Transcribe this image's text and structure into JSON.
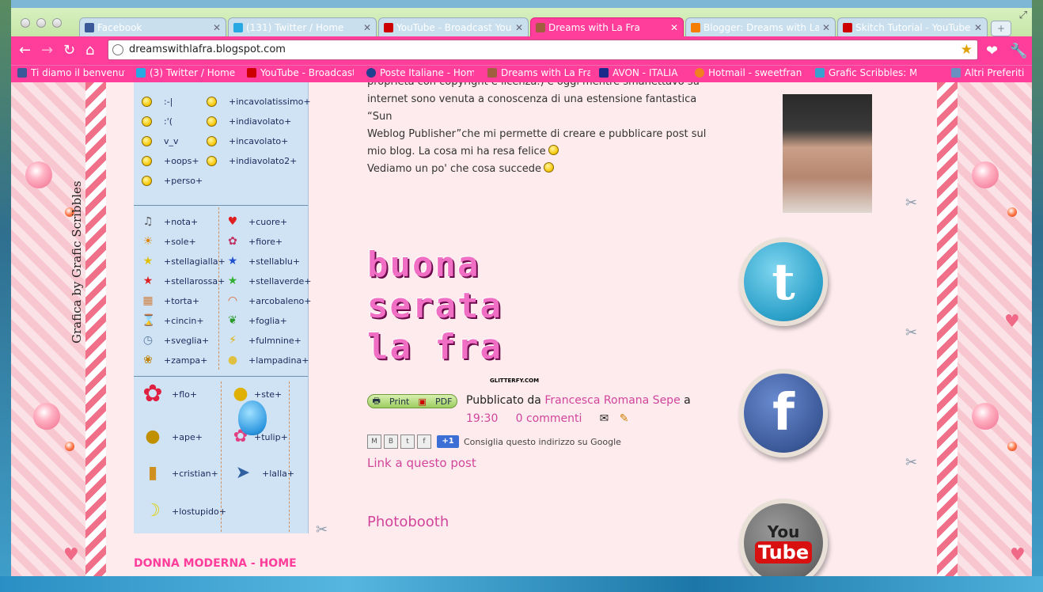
{
  "browser": {
    "tabs": [
      {
        "title": "Facebook",
        "color": "#3b5998"
      },
      {
        "title": "(131) Twitter / Home",
        "color": "#29a9e1"
      },
      {
        "title": "YouTube - Broadcast Yours",
        "color": "#cc0000"
      },
      {
        "title": "Dreams with La Fra",
        "color": "#a06040"
      },
      {
        "title": "Blogger: Dreams with La Fra",
        "color": "#f57d00"
      },
      {
        "title": "Skitch Tutorial - YouTube",
        "color": "#cc0000"
      }
    ],
    "url": "dreamswithlafra.blogspot.com",
    "bookmarks": [
      {
        "label": "Ti diamo il benvenuto",
        "color": "#3b5998"
      },
      {
        "label": "(3) Twitter / Home",
        "color": "#29a9e1"
      },
      {
        "label": "YouTube - Broadcast",
        "color": "#cc0000"
      },
      {
        "label": "Poste Italiane - Home",
        "color": "#1f3f8f"
      },
      {
        "label": "Dreams with La Fra",
        "color": "#a06040"
      },
      {
        "label": "AVON - ITALIA",
        "color": "#1a2a8a"
      },
      {
        "label": "Hotmail - sweetfrancy",
        "color": "#f08020"
      },
      {
        "label": "Grafic Scribbles: My",
        "color": "#3aa0d0"
      },
      {
        "label": "Altri Preferiti",
        "color": "#6a8fc0"
      }
    ]
  },
  "sidebar": {
    "credit": "Grafica by Grafic Scribbles",
    "smileys_left": [
      ":-|",
      ":'(",
      "v_v",
      "+oops+",
      "+perso+"
    ],
    "smileys_right": [
      "+incavolatissimo+",
      "+indiavolato+",
      "+incavolato+",
      "+indiavolato2+"
    ],
    "icons_left": [
      "+nota+",
      "+sole+",
      "+stellagialla+",
      "+stellarossa+",
      "+torta+",
      "+cincin+",
      "+sveglia+",
      "+zampa+"
    ],
    "icons_right": [
      "+cuore+",
      "+fiore+",
      "+stellablu+",
      "+stellaverde+",
      "+arcobaleno+",
      "+foglia+",
      "+fulmnine+",
      "+lampadina+"
    ],
    "anim_left": [
      "+flo+",
      "+ape+",
      "+cristian+",
      "+lostupido+"
    ],
    "anim_right": [
      "+ste+",
      "+tulip+",
      "+lalla+"
    ],
    "donna_link": "DONNA MODERNA - HOME"
  },
  "post": {
    "line1": "proprietà con copyright e licenza.) e oggi mentre smanettavo su",
    "line2": "internet sono venuta a conoscenza di una estensione fantastica “Sun",
    "line3": "Weblog Publisher”che mi permette di creare e pubblicare post sul",
    "line4": "mio blog. La cosa mi ha resa felice",
    "line5": "Vediamo un po' che cosa succede",
    "glitter_lines": [
      "buona",
      "serata",
      "la fra"
    ],
    "glitter_watermark": "GLITTERFY.COM",
    "print_label": "Print",
    "pdf_label": "PDF",
    "published_by": "Pubblicato da",
    "author": "Francesca Romana Sepe",
    "at": "a",
    "time": "19:30",
    "comments": "0 commenti",
    "plus_one": "+1",
    "recommend": "Consiglia questo indirizzo su Google",
    "link_to_post": "Link a questo post",
    "next_title": "Photobooth"
  },
  "social": {
    "twitter_letter": "t",
    "facebook_letter": "f",
    "youtube_top": "You",
    "youtube_bottom": "Tube"
  }
}
